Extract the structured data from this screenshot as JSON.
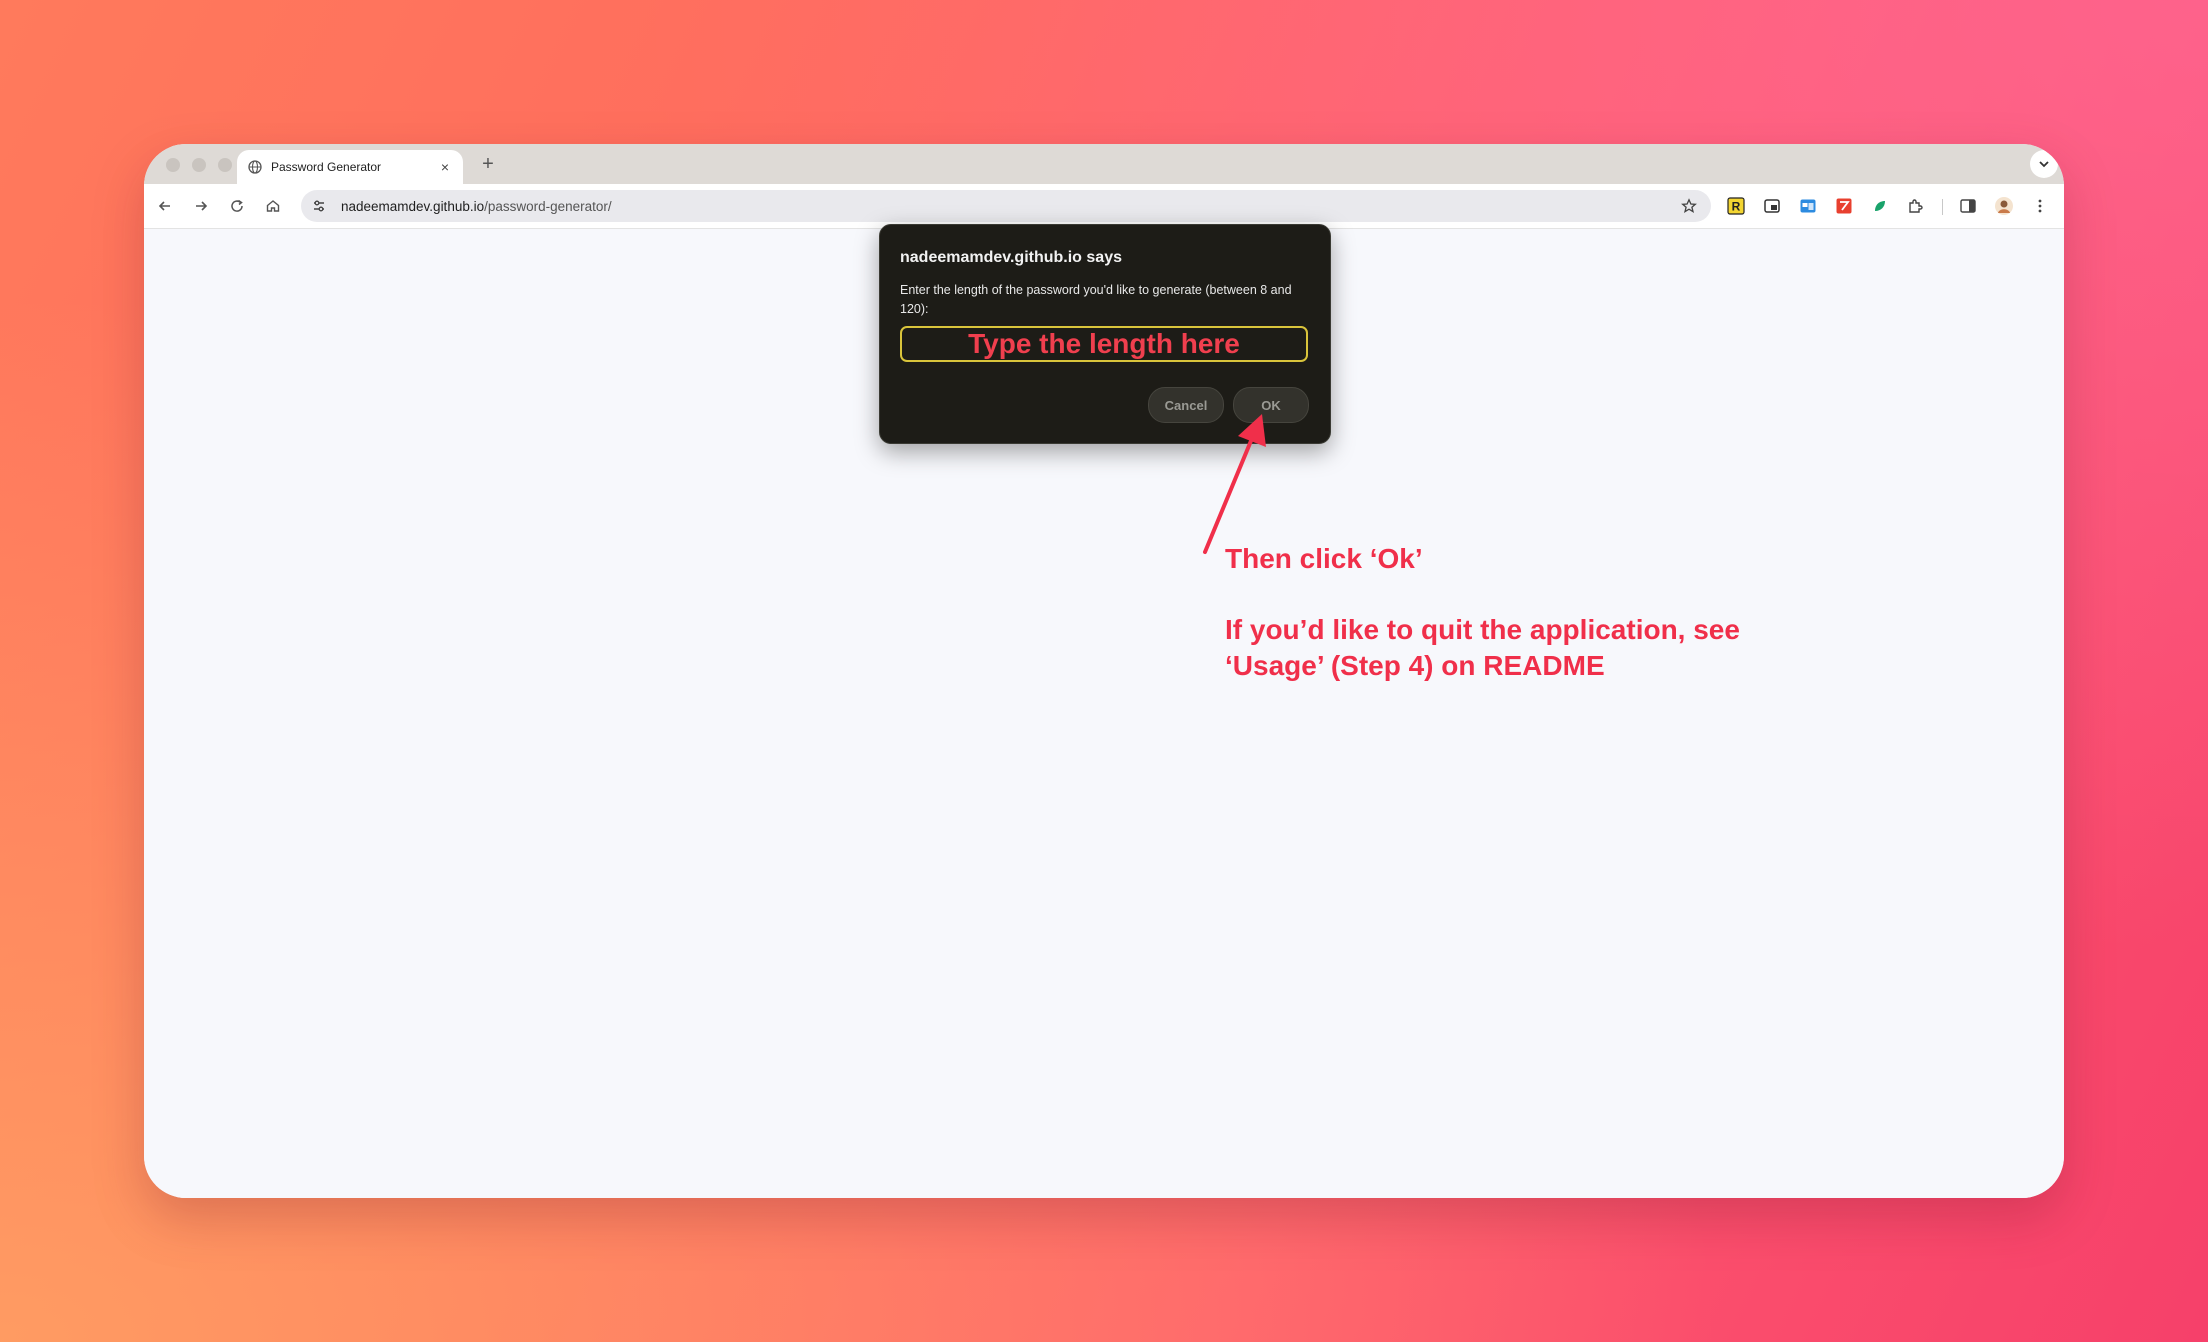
{
  "browser": {
    "tab_title": "Password Generator",
    "tab_close": "×",
    "new_tab": "+",
    "url_host": "nadeemamdev.github.io",
    "url_path": "/password-generator/"
  },
  "dialog": {
    "title": "nadeemamdev.github.io says",
    "message": "Enter the length of the password you'd like to generate (between 8 and 120):",
    "input_hint": "Type the length here",
    "cancel_label": "Cancel",
    "ok_label": "OK"
  },
  "annotations": {
    "step": "Then click ‘Ok’",
    "quit_line1": "If you’d like to quit the application, see",
    "quit_line2": "‘Usage’ (Step 4) on README"
  },
  "colors": {
    "annotation": "#f02f4a",
    "input_border": "#d9c43b",
    "dialog_bg": "#1d1c17"
  },
  "icons": [
    "globe-icon",
    "close-icon",
    "plus-icon",
    "chevron-down-icon",
    "back-icon",
    "forward-icon",
    "reload-icon",
    "home-icon",
    "site-settings-icon",
    "star-icon",
    "extension-icons",
    "puzzle-icon",
    "sidepanel-icon",
    "avatar",
    "more-icon"
  ]
}
